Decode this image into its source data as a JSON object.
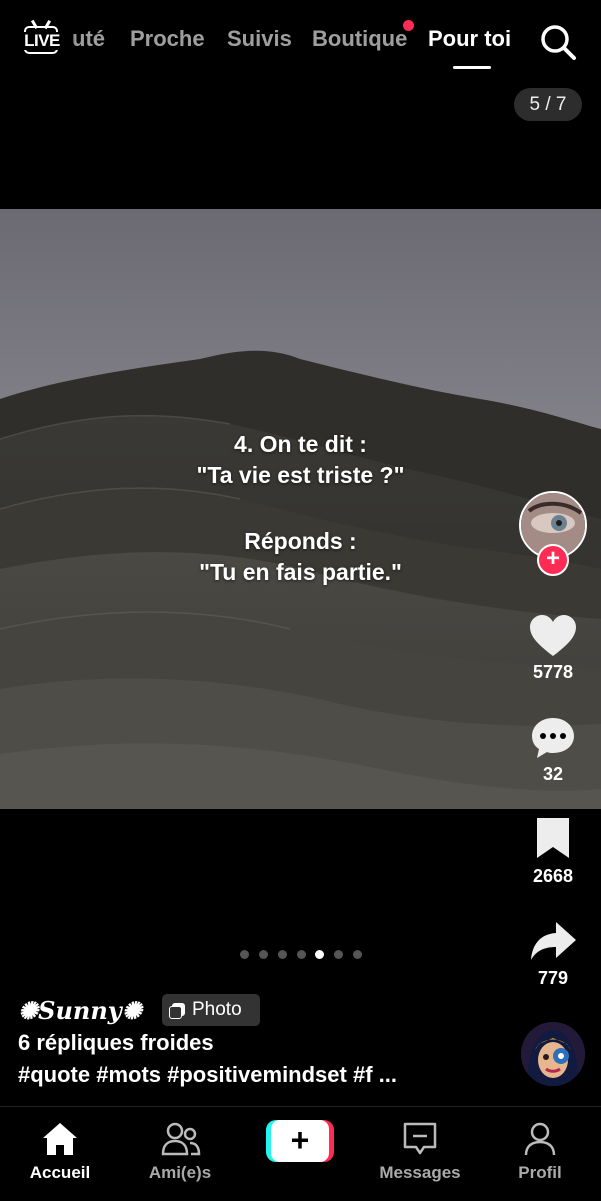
{
  "top_nav": {
    "live_label": "LIVE",
    "tabs": [
      {
        "label": "uté",
        "active": false
      },
      {
        "label": "Proche",
        "active": false
      },
      {
        "label": "Suivis",
        "active": false
      },
      {
        "label": "Boutique",
        "active": false,
        "notification_dot": true
      },
      {
        "label": "Pour toi",
        "active": true
      }
    ],
    "search_icon": "search-icon"
  },
  "page_counter": "5 / 7",
  "post": {
    "overlay_lines": [
      "4. On te dit :",
      "\"Ta vie est triste ?\"",
      "",
      "Réponds :",
      "\"Tu en fais partie.\""
    ],
    "carousel": {
      "total": 7,
      "current_index": 4
    }
  },
  "actions": {
    "likes": "5778",
    "comments": "32",
    "saves": "2668",
    "shares": "779",
    "follow_symbol": "+"
  },
  "caption": {
    "author": "✺𝑺𝒖𝒏𝒏𝒚✺",
    "badge": "Photo",
    "title": "6 répliques froides",
    "hashtags": "#quote #mots #positivemindset #f ..."
  },
  "bottom_nav": {
    "items": [
      {
        "label": "Accueil",
        "icon": "home-icon",
        "active": true
      },
      {
        "label": "Ami(e)s",
        "icon": "friends-icon",
        "active": false
      },
      {
        "label": "",
        "icon": "create-icon",
        "active": false
      },
      {
        "label": "Messages",
        "icon": "messages-icon",
        "active": false
      },
      {
        "label": "Profil",
        "icon": "profile-icon",
        "active": false
      }
    ],
    "create_symbol": "+"
  },
  "colors": {
    "accent": "#fe2c55",
    "cyan": "#25f4ee",
    "background": "#000000"
  }
}
